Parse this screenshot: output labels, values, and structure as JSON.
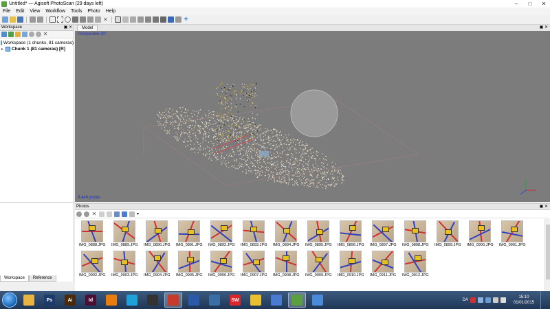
{
  "window": {
    "title": "Untitled* — Agisoft PhotoScan (29 days left)"
  },
  "menu": [
    "File",
    "Edit",
    "View",
    "Workflow",
    "Tools",
    "Photo",
    "Help"
  ],
  "toolbar": {
    "icons": [
      "new-icon",
      "open-icon",
      "save-icon",
      "undo-icon",
      "redo-icon",
      "select-icon",
      "zoom-icon",
      "rotate-icon",
      "move-icon",
      "resize-icon",
      "crop-icon",
      "ruler-icon",
      "delete-icon",
      "view-icon",
      "points-icon",
      "dense-icon",
      "mesh-icon",
      "texture-icon",
      "cameras-icon",
      "show-icon",
      "hide-icon",
      "align-icon"
    ]
  },
  "workspace": {
    "header": "Workspace",
    "root_label": "Workspace (1 chunks, 81 cameras)",
    "chunk_label": "Chunk 1 (81 cameras) [R]"
  },
  "bottom_left_tabs": [
    "Workspace",
    "Reference"
  ],
  "model": {
    "tab": "Model",
    "projection": "Perspective 30°",
    "points": "8,449 points"
  },
  "photos": {
    "header": "Photos",
    "thumbnails": [
      "IMG_0888.JPG",
      "IMG_0889.JPG",
      "IMG_0890.JPG",
      "IMG_0891.JPG",
      "IMG_0892.JPG",
      "IMG_0893.JPG",
      "IMG_0894.JPG",
      "IMG_0895.JPG",
      "IMG_0896.JPG",
      "IMG_0897.JPG",
      "IMG_0898.JPG",
      "IMG_0899.JPG",
      "IMG_0900.JPG",
      "IMG_0901.JPG",
      "IMG_0902.JPG",
      "IMG_0903.JPG",
      "IMG_0904.JPG",
      "IMG_0905.JPG",
      "IMG_0906.JPG",
      "IMG_0907.JPG",
      "IMG_0908.JPG",
      "IMG_0909.JPG",
      "IMG_0910.JPG",
      "IMG_0911.JPG",
      "IMG_0912.JPG"
    ]
  },
  "taskbar": {
    "apps": [
      {
        "name": "explorer",
        "label": "",
        "color": "#e8b640"
      },
      {
        "name": "photoshop",
        "label": "Ps",
        "color": "#1d3b6b"
      },
      {
        "name": "illustrator",
        "label": "Ai",
        "color": "#4a2a0a"
      },
      {
        "name": "indesign",
        "label": "Id",
        "color": "#4a0f35"
      },
      {
        "name": "blender",
        "label": "",
        "color": "#e87d0d"
      },
      {
        "name": "app-triangle",
        "label": "",
        "color": "#1ea1d6"
      },
      {
        "name": "app-bird",
        "label": "",
        "color": "#333333"
      },
      {
        "name": "sketchup",
        "label": "",
        "color": "#c83a2a"
      },
      {
        "name": "virtualbox",
        "label": "",
        "color": "#2b5aa8"
      },
      {
        "name": "app-cube",
        "label": "",
        "color": "#3a6ea5"
      },
      {
        "name": "solidworks",
        "label": "SW",
        "color": "#d9262c"
      },
      {
        "name": "chrome",
        "label": "",
        "color": "#e8c030"
      },
      {
        "name": "settings",
        "label": "",
        "color": "#4a7bd0"
      },
      {
        "name": "photoscan",
        "label": "",
        "color": "#5aa040"
      },
      {
        "name": "media",
        "label": "",
        "color": "#4a8ad8"
      }
    ],
    "lang": "DA",
    "time": "15:10",
    "date": "01/01/2015"
  },
  "colors": {
    "viewport": "#7c7c7c",
    "cloud": "#e8d6b8",
    "label_blue": "#1a2fd0"
  }
}
